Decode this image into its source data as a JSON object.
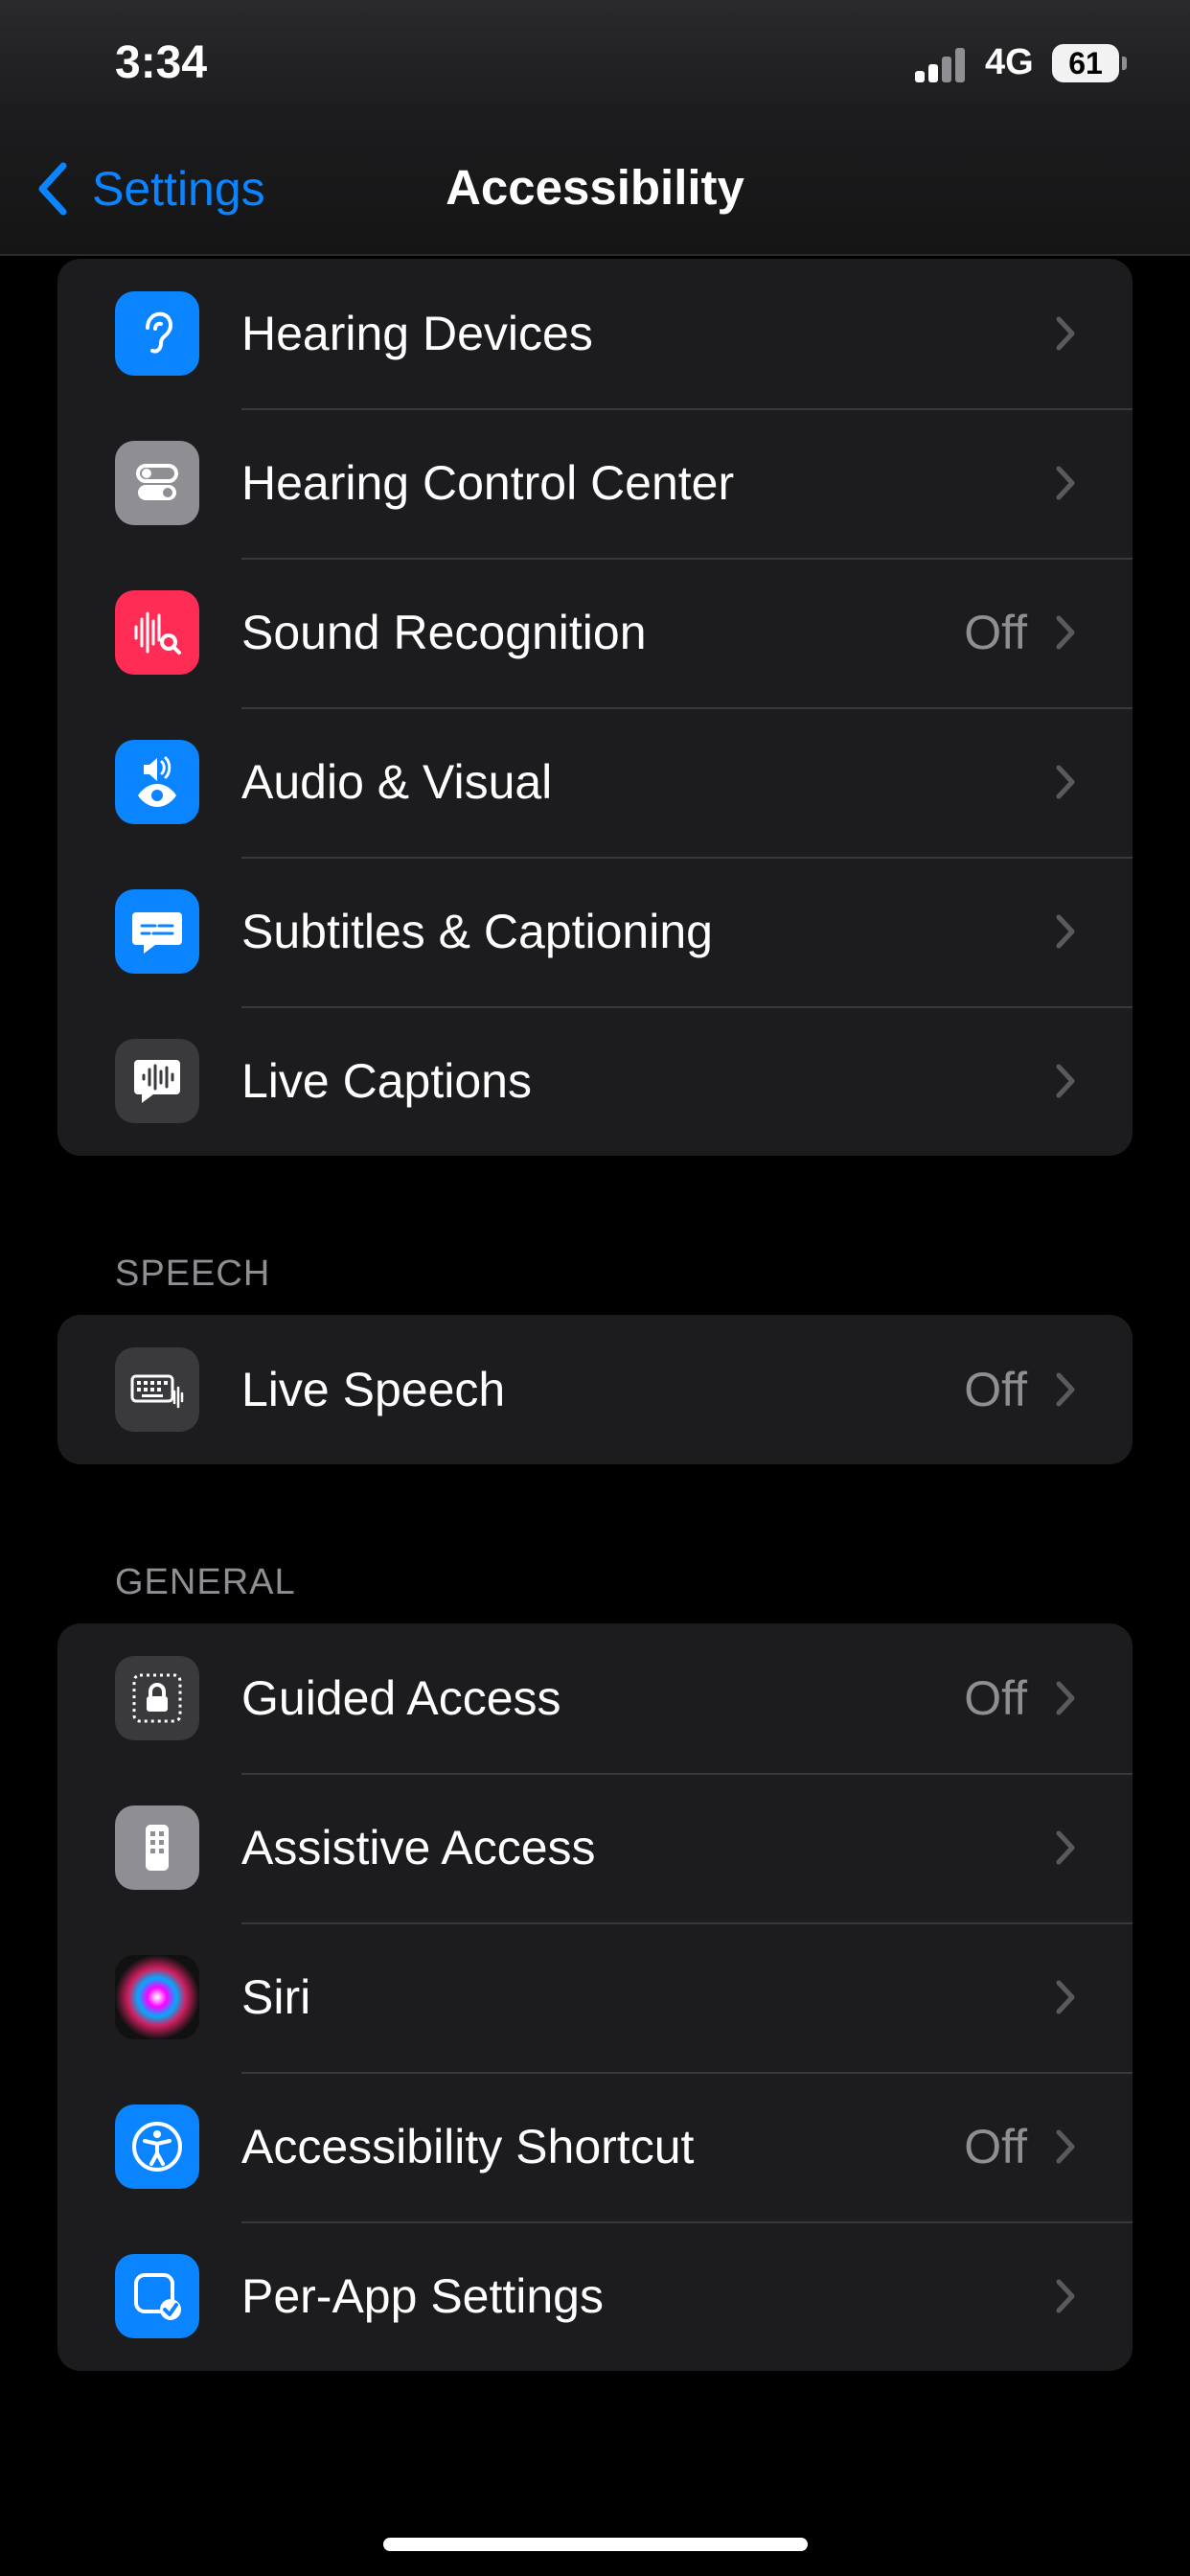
{
  "status_bar": {
    "time": "3:34",
    "network": "4G",
    "battery": "61"
  },
  "nav": {
    "back_label": "Settings",
    "title": "Accessibility"
  },
  "hearing_group": [
    {
      "label": "Hearing Devices",
      "value": "",
      "icon": "ear-icon",
      "icon_color": "#0a84ff"
    },
    {
      "label": "Hearing Control Center",
      "value": "",
      "icon": "toggles-icon",
      "icon_color": "#8e8e93"
    },
    {
      "label": "Sound Recognition",
      "value": "Off",
      "icon": "waveform-search-icon",
      "icon_color": "#ff2d55"
    },
    {
      "label": "Audio & Visual",
      "value": "",
      "icon": "speaker-eye-icon",
      "icon_color": "#0a84ff"
    },
    {
      "label": "Subtitles & Captioning",
      "value": "",
      "icon": "caption-bubble-icon",
      "icon_color": "#0a84ff"
    },
    {
      "label": "Live Captions",
      "value": "",
      "icon": "waveform-bubble-icon",
      "icon_color": "#3a3a3c"
    }
  ],
  "speech_section": {
    "header": "SPEECH",
    "items": [
      {
        "label": "Live Speech",
        "value": "Off",
        "icon": "keyboard-waveform-icon",
        "icon_color": "#3a3a3c"
      }
    ]
  },
  "general_section": {
    "header": "GENERAL",
    "items": [
      {
        "label": "Guided Access",
        "value": "Off",
        "icon": "lock-dotted-icon",
        "icon_color": "#3a3a3c"
      },
      {
        "label": "Assistive Access",
        "value": "",
        "icon": "phone-grid-icon",
        "icon_color": "#8e8e93"
      },
      {
        "label": "Siri",
        "value": "",
        "icon": "siri-icon",
        "icon_color": "#1c1c1e"
      },
      {
        "label": "Accessibility Shortcut",
        "value": "Off",
        "icon": "accessibility-icon",
        "icon_color": "#0a84ff"
      },
      {
        "label": "Per-App Settings",
        "value": "",
        "icon": "app-check-icon",
        "icon_color": "#0a84ff"
      }
    ]
  },
  "colors": {
    "accent": "#0a84ff",
    "background": "#000000",
    "cell": "#1c1c1e",
    "secondary_text": "#8e8e93"
  }
}
